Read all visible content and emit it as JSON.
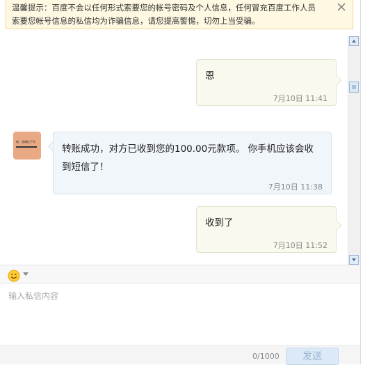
{
  "warning": {
    "line1": "温馨提示：百度不会以任何形式索要您的帐号密码及个人信息，任何冒充百度工作人员",
    "line2": "索要您帐号信息的私信均为诈骗信息，请您提高警惕，切勿上当受骗。",
    "close_icon": "close-icon"
  },
  "messages": [
    {
      "sender": "me",
      "text": "恩",
      "time": "7月10日 11:41"
    },
    {
      "sender": "them",
      "text_line1": "转账成功，对方已收到您的100.00元款项。 你手机应该会收",
      "text_line2": "到短信了！",
      "time": "7月10日 11:38"
    },
    {
      "sender": "me",
      "text": "收到了",
      "time": "7月10日 11:52"
    }
  ],
  "avatar": {
    "caption": "新、张福队下号",
    "color": "#e8a984"
  },
  "toolbar": {
    "emoji_icon": "smiley-icon"
  },
  "composer": {
    "placeholder": "输入私信内容",
    "value": ""
  },
  "footer": {
    "counter": "0/1000",
    "send_label": "发送"
  }
}
